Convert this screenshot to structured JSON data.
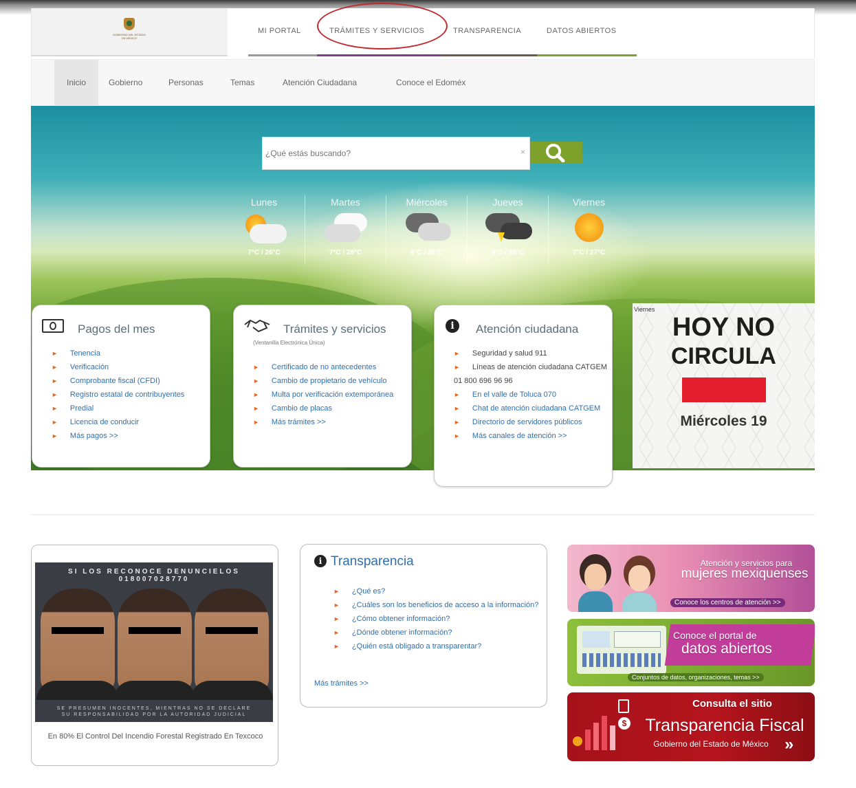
{
  "header": {
    "logo_text": "GOBIERNO DEL ESTADO DE MÉXICO",
    "topnav": [
      {
        "label": "MI PORTAL",
        "color": "#9a9a9a"
      },
      {
        "label": "TRÁMITES Y SERVICIOS",
        "color": "#7b3f8f"
      },
      {
        "label": "TRANSPARENCIA",
        "color": "#6a5a4a"
      },
      {
        "label": "DATOS ABIERTOS",
        "color": "#7da12b"
      }
    ]
  },
  "subnav": {
    "items": [
      "Inicio",
      "Gobierno",
      "Personas",
      "Temas",
      "Atención Ciudadana",
      "Conoce el Edoméx"
    ],
    "active": "Inicio"
  },
  "search": {
    "placeholder": "¿Qué estás buscando?",
    "clear_icon": "×",
    "button_icon": "search-icon"
  },
  "weather": [
    {
      "day": "Lunes",
      "temp": "7°C / 26°C",
      "icon": "sun-cloud-icon"
    },
    {
      "day": "Martes",
      "temp": "7°C / 26°C",
      "icon": "cloud-icon"
    },
    {
      "day": "Miércoles",
      "temp": "6°C / 26°C",
      "icon": "rain-cloud-icon"
    },
    {
      "day": "Jueves",
      "temp": "6°C / 26°C",
      "icon": "storm-icon"
    },
    {
      "day": "Viernes",
      "temp": "7°C / 27°C",
      "icon": "sun-icon"
    }
  ],
  "pagos": {
    "title": "Pagos del mes",
    "items": [
      "Tenencia",
      "Verificación",
      "Comprobante fiscal (CFDI)",
      "Registro estatal de contribuyentes",
      "Predial",
      "Licencia de conducir",
      "Más pagos >>"
    ]
  },
  "tramites": {
    "title": "Trámites y servicios",
    "subtitle": "(Ventanilla Electrónica Única)",
    "items": [
      "Certificado de no antecedentes",
      "Cambio de propietario de vehículo",
      "Multa por verificación extemporánea",
      "Cambio de placas",
      "Más trámites >>"
    ]
  },
  "atencion": {
    "title": "Atención ciudadana",
    "items": [
      "Seguridad y salud 911",
      "Líneas de atención ciudadana CATGEM 01 800 696 96 96",
      "En el valle de Toluca 070",
      "Chat de atención ciudadana CATGEM",
      "Directorio de servidores públicos",
      "Más canales de atención >>"
    ]
  },
  "hoy_no_circula": {
    "small": "Viernes",
    "line1": "HOY NO",
    "line2": "CIRCULA",
    "day": "Miércoles 19",
    "color": "#e21e2c"
  },
  "news": {
    "poster_top1": "SI LOS RECONOCE DENUNCIELOS",
    "poster_top2": "018007028770",
    "poster_bottom1": "SE PRESUMEN INOCENTES, MIENTRAS NO SE DECLARE",
    "poster_bottom2": "SU RESPONSABILIDAD POR LA AUTORIDAD JUDICIAL",
    "caption": "En 80% El Control Del Incendio Forestal Registrado En Texcoco"
  },
  "transparencia": {
    "title": "Transparencia",
    "items": [
      "¿Qué es?",
      "¿Cuáles son los beneficios de acceso a la información?",
      "¿Cómo obtener información?",
      "¿Dónde obtener información?",
      "¿Quién está obligado a transparentar?"
    ],
    "more": "Más trámites >>"
  },
  "banners": {
    "mujeres": {
      "line1": "Atención y servicios para",
      "line2": "mujeres mexiquenses",
      "pill": "Conoce los centros de atención >>"
    },
    "datos": {
      "line1": "Conoce el portal de",
      "line2": "datos abiertos",
      "pill": "Conjuntos de datos, organizaciones, temas >>"
    },
    "fiscal": {
      "line1": "Consulta el sitio",
      "line2": "Transparencia Fiscal",
      "line3": "Gobierno del Estado de México",
      "arrow": "»"
    }
  }
}
